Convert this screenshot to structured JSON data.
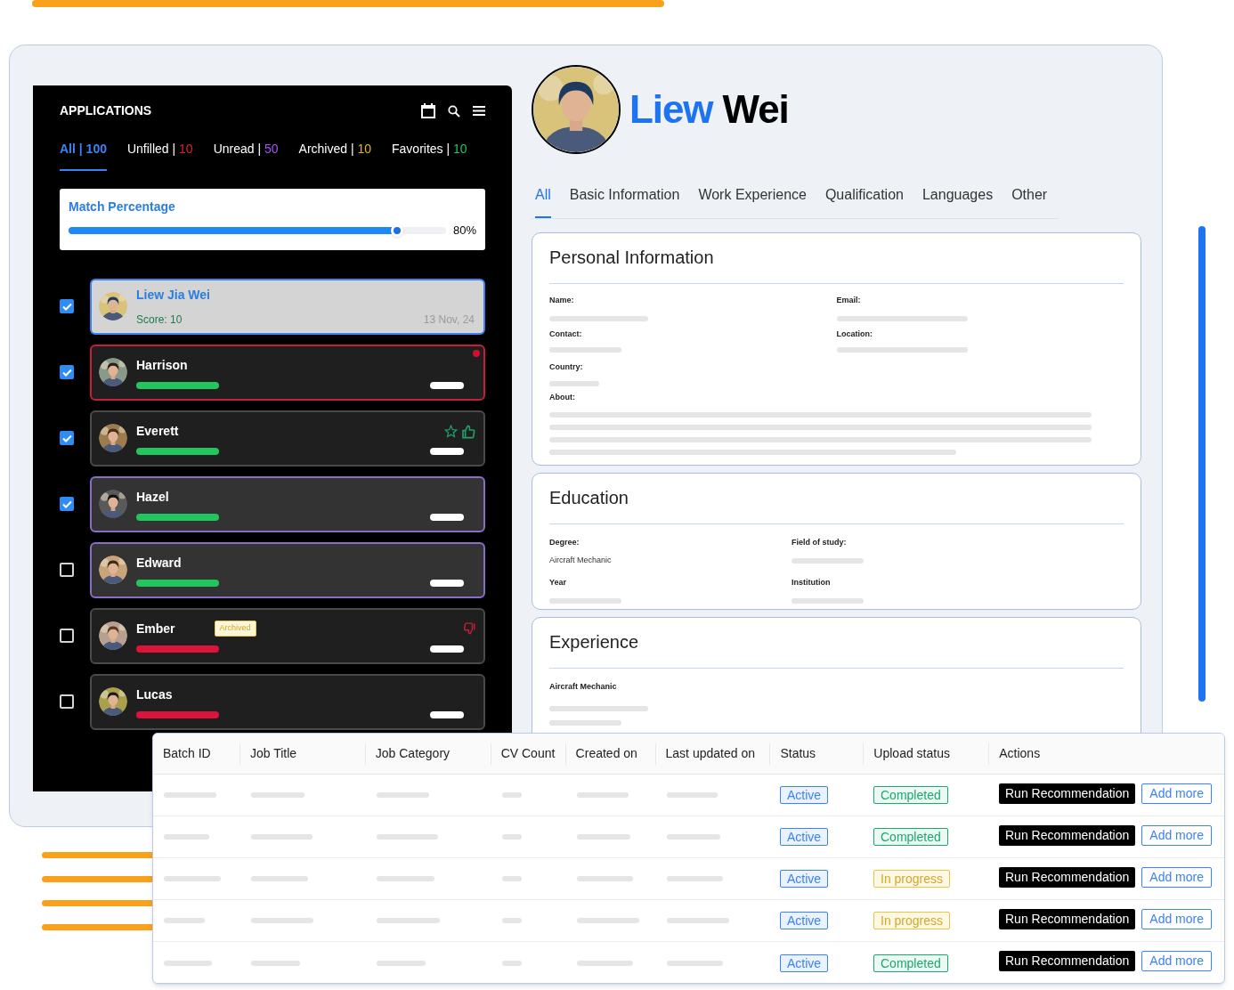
{
  "applications": {
    "title": "APPLICATIONS",
    "tabs": [
      {
        "label": "All | ",
        "count": "100",
        "color": "#3b82f6",
        "selected": true
      },
      {
        "label": "Unfilled | ",
        "count": "10",
        "color": "#dc2626",
        "selected": false
      },
      {
        "label": "Unread | ",
        "count": "50",
        "color": "#a855f7",
        "selected": false
      },
      {
        "label": "Archived | ",
        "count": "10",
        "color": "#eab308",
        "selected": false
      },
      {
        "label": "Favorites | ",
        "count": "10",
        "color": "#22c55e",
        "selected": false
      }
    ],
    "match": {
      "label": "Match Percentage",
      "level": 0.87,
      "reading": "80%"
    },
    "candidates": [
      {
        "name": "Liew Jia Wei",
        "score": "Score: 10",
        "date": "13 Nov, 24",
        "checked": true,
        "kind": "selected"
      },
      {
        "name": "Harrison",
        "checked": true,
        "kind": "flagged",
        "color": "#22c55e",
        "new": true
      },
      {
        "name": "Everett",
        "checked": true,
        "kind": "normal",
        "color": "#22c55e",
        "favorite": true
      },
      {
        "name": "Hazel",
        "checked": true,
        "kind": "highlighted",
        "color": "#22c55e"
      },
      {
        "name": "Edward",
        "checked": false,
        "kind": "highlighted",
        "color": "#22c55e"
      },
      {
        "name": "Ember",
        "checked": false,
        "kind": "normal",
        "color": "#dc143c",
        "badge": "Archived",
        "disliked": true
      },
      {
        "name": "Lucas",
        "checked": false,
        "kind": "normal",
        "color": "#dc143c"
      }
    ]
  },
  "profile": {
    "first_name": "Liew",
    "last_name": "Wei",
    "tabs": [
      {
        "label": "All",
        "selected": true
      },
      {
        "label": "Basic Information",
        "selected": false
      },
      {
        "label": "Work Experience",
        "selected": false
      },
      {
        "label": "Qualification",
        "selected": false
      },
      {
        "label": "Languages",
        "selected": false
      },
      {
        "label": "Other",
        "selected": false
      }
    ],
    "personal": {
      "title": "Personal Information",
      "name": "Name:",
      "email": "Email:",
      "contact": "Contact:",
      "location": "Location:",
      "country": "Country:",
      "about": "About:"
    },
    "education": {
      "title": "Education",
      "degree": "Degree:",
      "degree_value": "Aircraft Mechanic",
      "field": "Field of study:",
      "year": "Year",
      "institution": "Institution"
    },
    "experience": {
      "title": "Experience",
      "role": "Aircraft Mechanic"
    }
  },
  "batches": {
    "columns": [
      "Batch ID",
      "Job Title",
      "Job Category",
      "CV Count",
      "Created on",
      "Last updated on",
      "Status",
      "Upload status",
      "Actions"
    ],
    "rows": [
      {
        "status": "Active",
        "upload": "Completed",
        "kind": "done",
        "run": "Run Recommendation",
        "add": "Add more"
      },
      {
        "status": "Active",
        "upload": "Completed",
        "kind": "done",
        "run": "Run Recommendation",
        "add": "Add more"
      },
      {
        "status": "Active",
        "upload": "In progress",
        "kind": "progress",
        "run": "Run Recommendation",
        "add": "Add more"
      },
      {
        "status": "Active",
        "upload": "In progress",
        "kind": "progress",
        "run": "Run Recommendation",
        "add": "Add more"
      },
      {
        "status": "Active",
        "upload": "Completed",
        "kind": "done",
        "run": "Run Recommendation",
        "add": "Add more"
      }
    ]
  }
}
